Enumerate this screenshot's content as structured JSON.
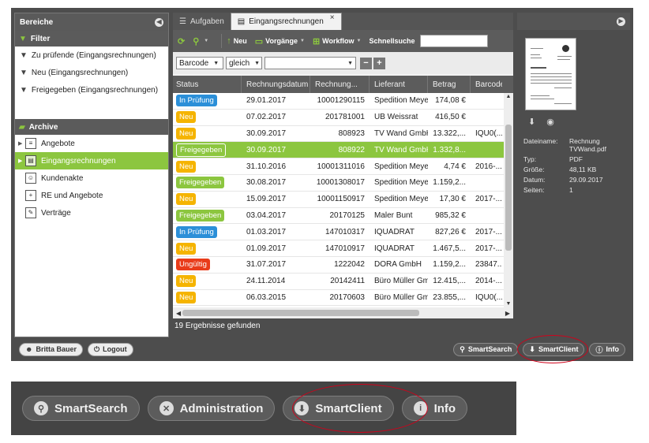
{
  "left_panel": {
    "title": "Bereiche",
    "filter_header": "Filter",
    "filters": [
      {
        "label": "Zu prüfende (Eingangsrechnungen)",
        "icon": "funnel-icon"
      },
      {
        "label": "Neu (Eingangsrechnungen)",
        "icon": "funnel-icon"
      },
      {
        "label": "Freigegeben (Eingangsrechnungen)",
        "icon": "funnel-icon"
      }
    ],
    "archive_header": "Archive",
    "archives": [
      {
        "label": "Angebote",
        "icon": "document-icon",
        "expand": "▶"
      },
      {
        "label": "Eingangsrechnungen",
        "icon": "invoice-icon",
        "expand": "▶",
        "selected": true
      },
      {
        "label": "Kundenakte",
        "icon": "person-icon",
        "expand": ""
      },
      {
        "label": "RE und Angebote",
        "icon": "folder-plus-icon",
        "expand": ""
      },
      {
        "label": "Verträge",
        "icon": "contract-icon",
        "expand": ""
      }
    ]
  },
  "tabs": [
    {
      "label": "Aufgaben",
      "active": false
    },
    {
      "label": "Eingangsrechnungen",
      "active": true
    }
  ],
  "toolbar": {
    "new_label": "Neu",
    "processes_label": "Vorgänge",
    "workflow_label": "Workflow",
    "quicksearch_label": "Schnellsuche",
    "quicksearch_value": ""
  },
  "filter_row": {
    "field": "Barcode",
    "operator": "gleich",
    "value": ""
  },
  "grid": {
    "columns": [
      "Status",
      "Rechnungsdatum",
      "Rechnung...",
      "Lieferant",
      "Betrag",
      "Barcode"
    ],
    "rows": [
      {
        "status": "In Prüfung",
        "kind": "blue",
        "date": "29.01.2017",
        "nr": "10001290115",
        "supplier": "Spedition Meyer",
        "amount": "174,08 €",
        "barcode": ""
      },
      {
        "status": "Neu",
        "kind": "yel",
        "date": "07.02.2017",
        "nr": "201781001",
        "supplier": "UB Weissrat",
        "amount": "416,50 €",
        "barcode": ""
      },
      {
        "status": "Neu",
        "kind": "yel",
        "date": "30.09.2017",
        "nr": "808923",
        "supplier": "TV Wand GmbH",
        "amount": "13.322,...",
        "barcode": "IQU0(..."
      },
      {
        "status": "Freigegeben",
        "kind": "sel",
        "date": "30.09.2017",
        "nr": "808922",
        "supplier": "TV Wand GmbH",
        "amount": "1.332,8...",
        "barcode": "",
        "selected": true
      },
      {
        "status": "Neu",
        "kind": "yel",
        "date": "31.10.2016",
        "nr": "10001311016",
        "supplier": "Spedition Meyer",
        "amount": "4,74 €",
        "barcode": "2016-..."
      },
      {
        "status": "Freigegeben",
        "kind": "grn",
        "date": "30.08.2017",
        "nr": "10001308017",
        "supplier": "Spedition Meyer",
        "amount": "1.159,2...",
        "barcode": ""
      },
      {
        "status": "Neu",
        "kind": "yel",
        "date": "15.09.2017",
        "nr": "10001150917",
        "supplier": "Spedition Meyer",
        "amount": "17,30 €",
        "barcode": "2017-..."
      },
      {
        "status": "Freigegeben",
        "kind": "grn",
        "date": "03.04.2017",
        "nr": "20170125",
        "supplier": "Maler Bunt",
        "amount": "985,32 €",
        "barcode": ""
      },
      {
        "status": "In Prüfung",
        "kind": "blue",
        "date": "01.03.2017",
        "nr": "147010317",
        "supplier": "IQUADRAT",
        "amount": "827,26 €",
        "barcode": "2017-..."
      },
      {
        "status": "Neu",
        "kind": "yel",
        "date": "01.09.2017",
        "nr": "147010917",
        "supplier": "IQUADRAT",
        "amount": "1.467,5...",
        "barcode": "2017-..."
      },
      {
        "status": "Ungültig",
        "kind": "red",
        "date": "31.07.2017",
        "nr": "1222042",
        "supplier": "DORA GmbH",
        "amount": "1.159,2...",
        "barcode": "23847..."
      },
      {
        "status": "Neu",
        "kind": "yel",
        "date": "24.11.2014",
        "nr": "20142411",
        "supplier": "Büro Müller GmbH",
        "amount": "12.415,...",
        "barcode": "2014-..."
      },
      {
        "status": "Neu",
        "kind": "yel",
        "date": "06.03.2015",
        "nr": "20170603",
        "supplier": "Büro Müller GmbH",
        "amount": "23.855,...",
        "barcode": "IQU0(..."
      }
    ],
    "result_text": "19 Ergebnisse gefunden"
  },
  "preview": {
    "meta": [
      {
        "key": "Dateiname:",
        "value": "Rechnung TVWand.pdf"
      },
      {
        "key": "Typ:",
        "value": "PDF"
      },
      {
        "key": "Größe:",
        "value": "48,11 KB"
      },
      {
        "key": "Datum:",
        "value": "29.09.2017"
      },
      {
        "key": "Seiten:",
        "value": "1"
      }
    ]
  },
  "bottom_bar": {
    "user": "Britta Bauer",
    "logout": "Logout",
    "smartsearch": "SmartSearch",
    "smartclient": "SmartClient",
    "info": "Info"
  },
  "zoom_bar": {
    "smartsearch": "SmartSearch",
    "administration": "Administration",
    "smartclient": "SmartClient",
    "info": "Info"
  },
  "colors": {
    "accent_green": "#8cc63f",
    "badge_blue": "#2b8fd8",
    "badge_yellow": "#f5b400",
    "badge_red": "#e93c1a",
    "highlight_ring": "#d0021b"
  }
}
